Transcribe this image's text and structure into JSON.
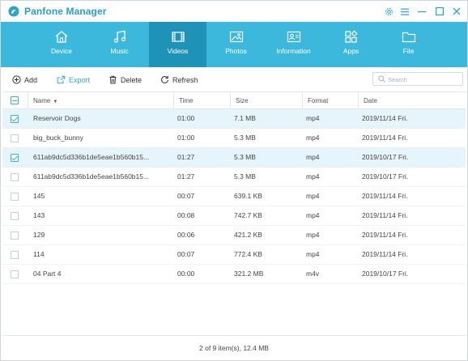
{
  "app": {
    "title": "Panfone Manager"
  },
  "colors": {
    "accent": "#3cb8dd",
    "active_tab": "#1e93b7",
    "checked_row": "#e6f4fb"
  },
  "window_controls": [
    "gear-icon",
    "menu-icon",
    "minimize-icon",
    "maximize-icon",
    "close-icon"
  ],
  "nav": {
    "items": [
      {
        "label": "Device",
        "icon": "home-icon",
        "active": false
      },
      {
        "label": "Music",
        "icon": "music-note-icon",
        "active": false
      },
      {
        "label": "Videos",
        "icon": "film-icon",
        "active": true
      },
      {
        "label": "Photos",
        "icon": "image-icon",
        "active": false
      },
      {
        "label": "Information",
        "icon": "contact-card-icon",
        "active": false
      },
      {
        "label": "Apps",
        "icon": "apps-grid-icon",
        "active": false
      },
      {
        "label": "File",
        "icon": "folder-icon",
        "active": false
      }
    ]
  },
  "toolbar": {
    "add_label": "Add",
    "export_label": "Export",
    "delete_label": "Delete",
    "refresh_label": "Refresh"
  },
  "search": {
    "placeholder": "Search",
    "value": ""
  },
  "table": {
    "columns": [
      "Name",
      "Time",
      "Size",
      "Format",
      "Date"
    ],
    "sort_column": "Name",
    "header_checkbox": "partial",
    "rows": [
      {
        "checked": true,
        "name": "Reservoir Dogs",
        "time": "01:00",
        "size": "7.1 MB",
        "format": "mp4",
        "date": "2019/11/14 Fri."
      },
      {
        "checked": false,
        "name": "big_buck_bunny",
        "time": "01:00",
        "size": "5.3 MB",
        "format": "mp4",
        "date": "2019/11/14 Fri."
      },
      {
        "checked": true,
        "name": "611ab9dc5d336b1de5eae1b560b15...",
        "time": "01:27",
        "size": "5.3 MB",
        "format": "mp4",
        "date": "2019/10/17 Fri."
      },
      {
        "checked": false,
        "name": "611ab9dc5d336b1de5eae1b560b15...",
        "time": "01:27",
        "size": "5.3 MB",
        "format": "mp4",
        "date": "2019/10/17 Fri."
      },
      {
        "checked": false,
        "name": "145",
        "time": "00:07",
        "size": "639.1 KB",
        "format": "mp4",
        "date": "2019/11/14 Fri."
      },
      {
        "checked": false,
        "name": "143",
        "time": "00:08",
        "size": "742.7 KB",
        "format": "mp4",
        "date": "2019/11/14 Fri."
      },
      {
        "checked": false,
        "name": "129",
        "time": "00:06",
        "size": "421.2 KB",
        "format": "mp4",
        "date": "2019/11/14 Fri."
      },
      {
        "checked": false,
        "name": "114",
        "time": "00:07",
        "size": "772.4 KB",
        "format": "mp4",
        "date": "2019/11/14 Fri."
      },
      {
        "checked": false,
        "name": "04 Part 4",
        "time": "00:00",
        "size": "321.2 MB",
        "format": "m4v",
        "date": "2019/10/17 Fri."
      }
    ]
  },
  "footer": {
    "status": "2 of 9 item(s), 12.4 MB"
  }
}
